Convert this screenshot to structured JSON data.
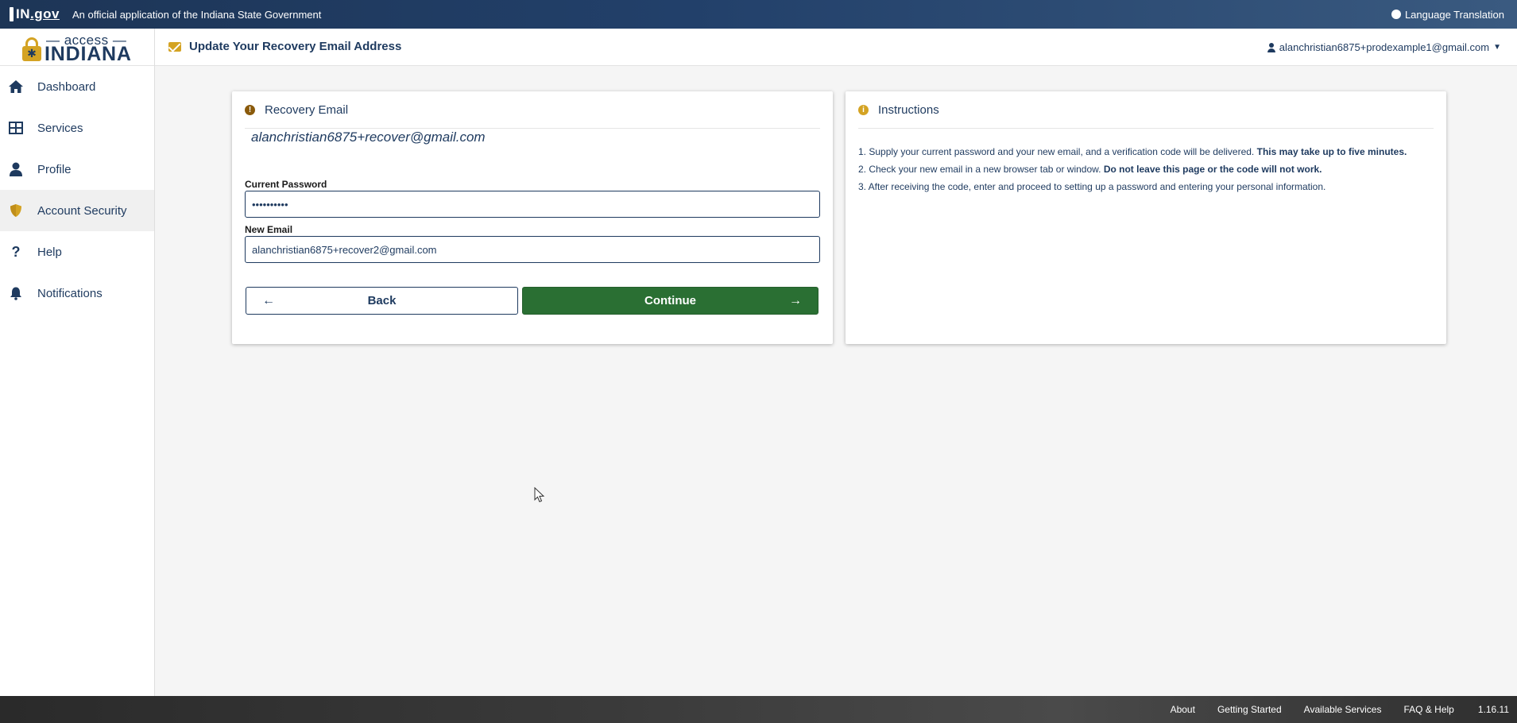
{
  "gov_bar": {
    "logo_text": "IN",
    "logo_suffix": ".gov",
    "official_text": "An official application of the Indiana State Government",
    "language_label": "Language Translation"
  },
  "header": {
    "logo_access": "— access —",
    "logo_indiana": "INDIANA",
    "page_title": "Update Your Recovery Email Address",
    "user_email": "alanchristian6875+prodexample1@gmail.com"
  },
  "sidebar": {
    "items": [
      {
        "label": "Dashboard",
        "icon": "home-icon"
      },
      {
        "label": "Services",
        "icon": "grid-icon"
      },
      {
        "label": "Profile",
        "icon": "person-icon"
      },
      {
        "label": "Account Security",
        "icon": "shield-icon",
        "active": true
      },
      {
        "label": "Help",
        "icon": "question-icon"
      },
      {
        "label": "Notifications",
        "icon": "bell-icon"
      }
    ]
  },
  "recovery_card": {
    "title": "Recovery Email",
    "current_email": "alanchristian6875+recover@gmail.com",
    "password_label": "Current Password",
    "password_value": "••••••••••",
    "new_email_label": "New Email",
    "new_email_value": "alanchristian6875+recover2@gmail.com",
    "back_label": "Back",
    "continue_label": "Continue"
  },
  "instructions_card": {
    "title": "Instructions",
    "items": [
      {
        "text": "1. Supply your current password and your new email, and a verification code will be delivered. ",
        "bold": "This may take up to five minutes."
      },
      {
        "text": "2. Check your new email in a new browser tab or window. ",
        "bold": "Do not leave this page or the code will not work."
      },
      {
        "text": "3. After receiving the code, enter and proceed to setting up a password and entering your personal information.",
        "bold": ""
      }
    ]
  },
  "footer": {
    "links": [
      "About",
      "Getting Started",
      "Available Services",
      "FAQ & Help"
    ],
    "version": "1.16.11"
  },
  "colors": {
    "brand_navy": "#1e3a5f",
    "brand_gold": "#d4a323",
    "continue_green": "#2a6f33"
  }
}
